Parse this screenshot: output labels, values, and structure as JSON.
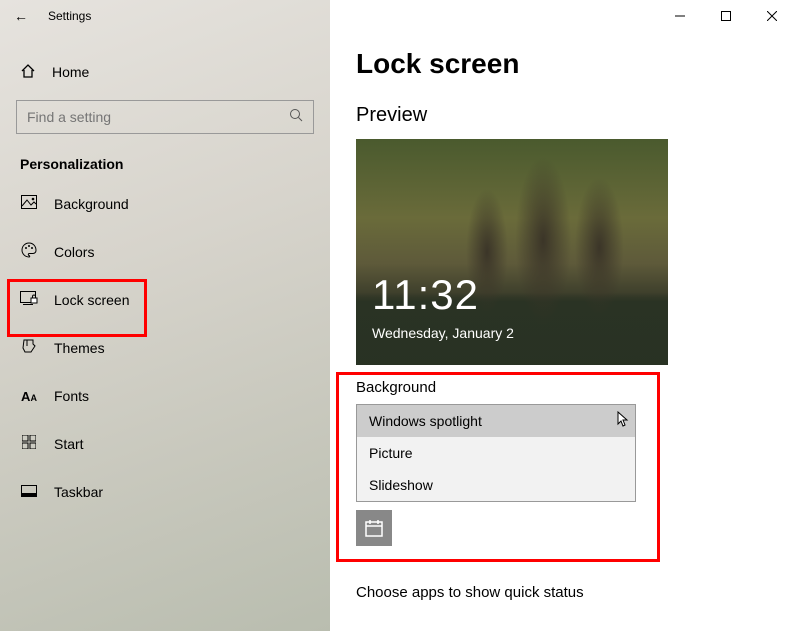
{
  "titlebar": {
    "back_glyph": "←",
    "title": "Settings"
  },
  "sidebar": {
    "home": "Home",
    "search_placeholder": "Find a setting",
    "section": "Personalization",
    "items": [
      {
        "label": "Background"
      },
      {
        "label": "Colors"
      },
      {
        "label": "Lock screen"
      },
      {
        "label": "Themes"
      },
      {
        "label": "Fonts"
      },
      {
        "label": "Start"
      },
      {
        "label": "Taskbar"
      }
    ]
  },
  "page": {
    "title": "Lock screen",
    "preview_label": "Preview",
    "clock": "11:32",
    "date": "Wednesday, January 2",
    "bg_label": "Background",
    "bg_options": [
      "Windows spotlight",
      "Picture",
      "Slideshow"
    ],
    "quick_status": "Choose apps to show quick status"
  }
}
